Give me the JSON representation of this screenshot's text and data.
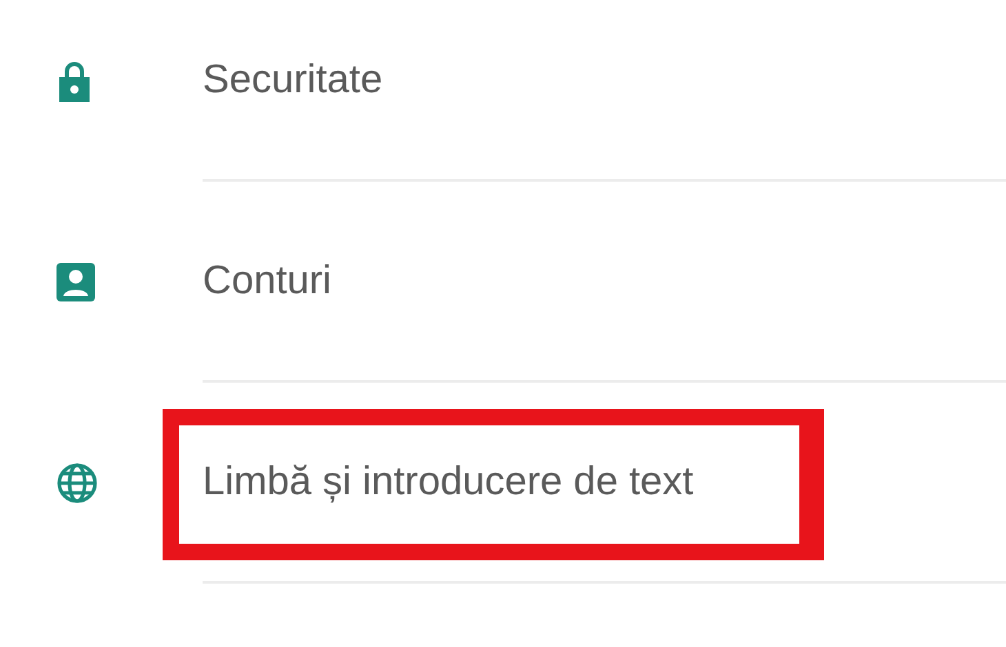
{
  "settings": {
    "items": [
      {
        "kind": "lock",
        "label": "Securitate",
        "highlighted": false
      },
      {
        "kind": "account",
        "label": "Conturi",
        "highlighted": false
      },
      {
        "kind": "globe",
        "label": "Limbă și introducere de text",
        "highlighted": true
      }
    ]
  }
}
